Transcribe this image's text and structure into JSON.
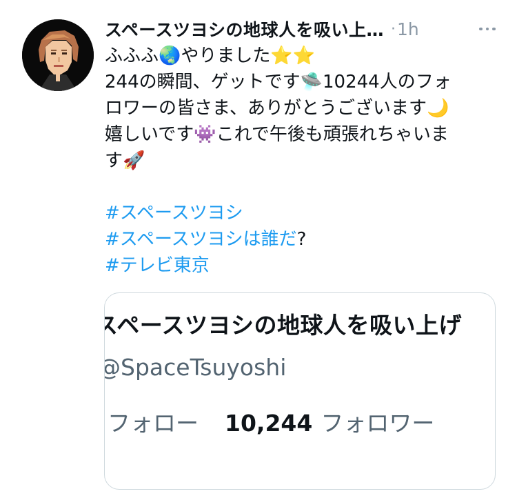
{
  "tweet": {
    "display_name": "スペースツヨシの地球人を吸い上…",
    "separator": "·",
    "timestamp": "1h",
    "body_lines": [
      "ふふふ🌏やりました⭐⭐",
      "244の瞬間、ゲットです🛸10244人のフォ",
      "ロワーの皆さま、ありがとうございます🌙",
      "嬉しいです👾これで午後も頑張れちゃいま",
      "す🚀"
    ],
    "hashtag_1": "#スペースツヨシ",
    "hashtag_2": "#スペースツヨシは誰だ",
    "hashtag_2_suffix": "?",
    "hashtag_3": "#テレビ東京"
  },
  "card": {
    "title": "スペースツヨシの地球人を吸い上げ",
    "handle": "@SpaceTsuyoshi",
    "following_label": "フォロー",
    "followers_count": "10,244",
    "followers_label": "フォロワー"
  },
  "icons": {
    "avatar": "avatar-icon",
    "more": "more-options-icon"
  },
  "colors": {
    "hashtag": "#1d9bf0",
    "secondary_text": "#536471",
    "timestamp": "#8b98a5",
    "card_border": "#cfd9de"
  }
}
